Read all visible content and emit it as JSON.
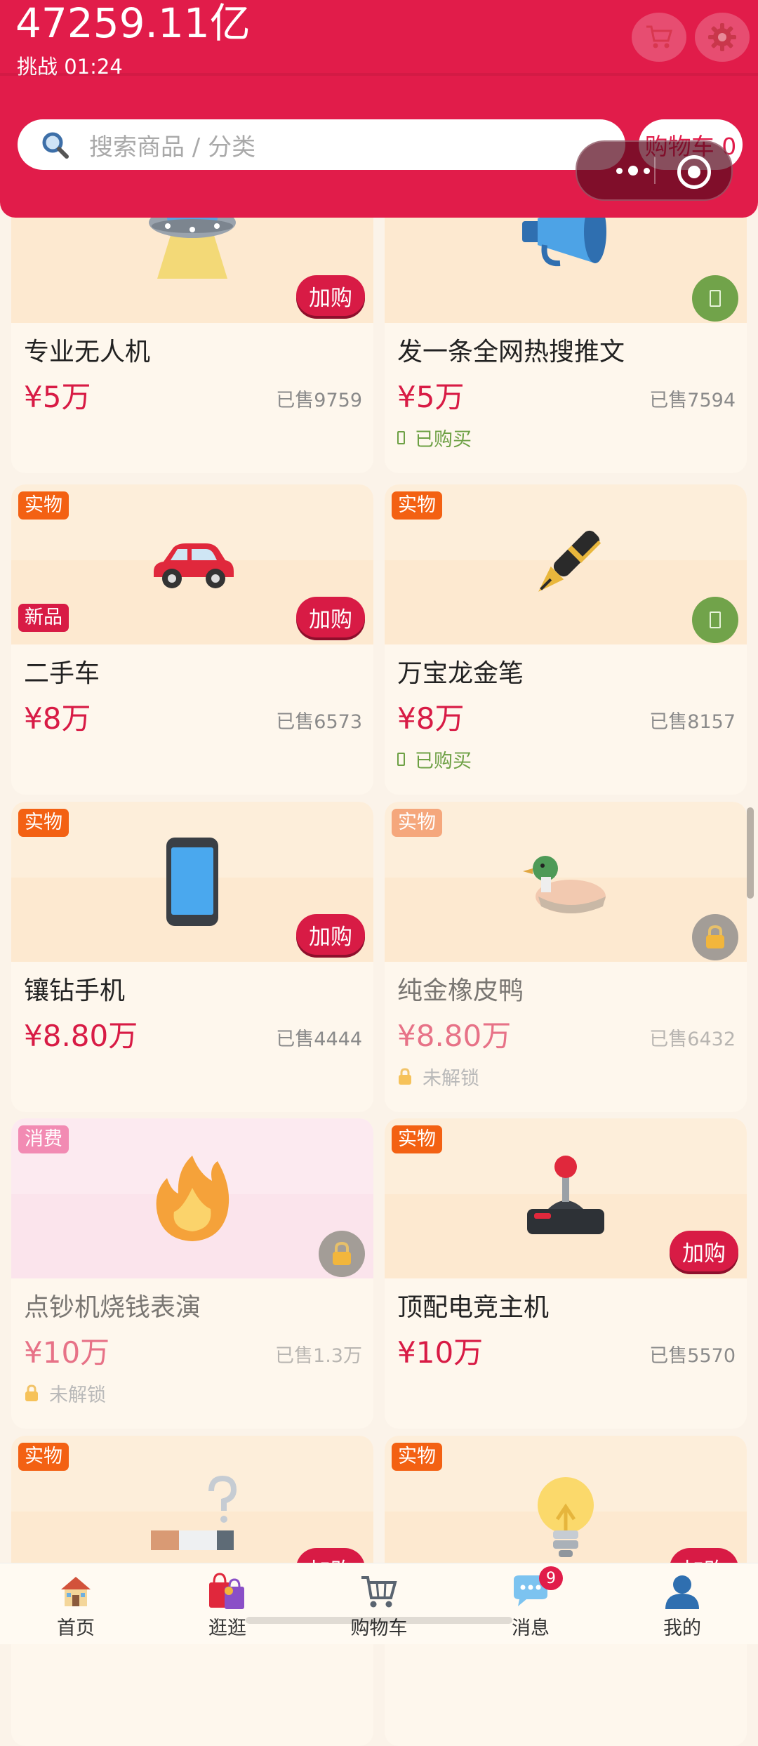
{
  "header": {
    "balance": "47259.11亿",
    "challenge_timer": "挑战 01:24",
    "search_placeholder": "搜索商品 / 分类",
    "cart_label": "购物车 0"
  },
  "colors": {
    "accent": "#e11c4a",
    "price": "#d81b45",
    "tag": "#f36113",
    "owned": "#6da044"
  },
  "add_label": "加购",
  "products": [
    {
      "name": "专业无人机",
      "price": "¥5万",
      "sold": "已售9759",
      "tag": "",
      "new": "",
      "status": "",
      "button": "add",
      "icon": "ufo-icon"
    },
    {
      "name": "发一条全网热搜推文",
      "price": "¥5万",
      "sold": "已售7594",
      "tag": "",
      "new": "",
      "status": "已购买",
      "button": "owned",
      "icon": "megaphone-icon"
    },
    {
      "name": "二手车",
      "price": "¥8万",
      "sold": "已售6573",
      "tag": "实物",
      "new": "新品",
      "status": "",
      "button": "add",
      "icon": "car-icon"
    },
    {
      "name": "万宝龙金笔",
      "price": "¥8万",
      "sold": "已售8157",
      "tag": "实物",
      "new": "",
      "status": "已购买",
      "button": "owned",
      "icon": "pen-icon"
    },
    {
      "name": "镶钻手机",
      "price": "¥8.80万",
      "sold": "已售4444",
      "tag": "实物",
      "new": "",
      "status": "",
      "button": "add",
      "icon": "phone-icon"
    },
    {
      "name": "纯金橡皮鸭",
      "price": "¥8.80万",
      "sold": "已售6432",
      "tag": "实物",
      "new": "",
      "status": "未解锁",
      "button": "locked",
      "icon": "duck-icon"
    },
    {
      "name": "点钞机烧钱表演",
      "price": "¥10万",
      "sold": "已售1.3万",
      "tag": "消费",
      "new": "",
      "status": "未解锁",
      "button": "locked",
      "icon": "fire-icon"
    },
    {
      "name": "顶配电竞主机",
      "price": "¥10万",
      "sold": "已售5570",
      "tag": "实物",
      "new": "",
      "status": "",
      "button": "add",
      "icon": "joystick-icon"
    },
    {
      "name": "",
      "price": "",
      "sold": "",
      "tag": "实物",
      "new": "",
      "status": "",
      "button": "add",
      "icon": "cigarette-icon"
    },
    {
      "name": "",
      "price": "",
      "sold": "",
      "tag": "实物",
      "new": "",
      "status": "",
      "button": "add",
      "icon": "lightbulb-icon"
    }
  ],
  "tabs": [
    {
      "label": "首页",
      "icon": "house-icon"
    },
    {
      "label": "逛逛",
      "icon": "shopping-bags-icon"
    },
    {
      "label": "购物车",
      "icon": "cart-icon"
    },
    {
      "label": "消息",
      "icon": "chat-bubble-icon",
      "badge": "9"
    },
    {
      "label": "我的",
      "icon": "user-icon"
    }
  ]
}
